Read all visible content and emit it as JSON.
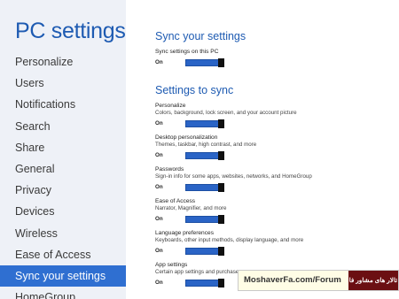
{
  "nav": {
    "title": "PC settings",
    "items": [
      {
        "label": "Personalize"
      },
      {
        "label": "Users"
      },
      {
        "label": "Notifications"
      },
      {
        "label": "Search"
      },
      {
        "label": "Share"
      },
      {
        "label": "General"
      },
      {
        "label": "Privacy"
      },
      {
        "label": "Devices"
      },
      {
        "label": "Wireless"
      },
      {
        "label": "Ease of Access"
      },
      {
        "label": "Sync your settings",
        "selected": true
      },
      {
        "label": "HomeGroup"
      }
    ]
  },
  "main": {
    "sync_section": {
      "title": "Sync your settings",
      "setting": {
        "label": "Sync settings on this PC",
        "state": "On",
        "value": true
      }
    },
    "settings_to_sync": {
      "title": "Settings to sync",
      "items": [
        {
          "label": "Personalize",
          "description": "Colors, background, lock screen, and your account picture",
          "state": "On",
          "value": true
        },
        {
          "label": "Desktop personalization",
          "description": "Themes, taskbar, high contrast, and more",
          "state": "On",
          "value": true
        },
        {
          "label": "Passwords",
          "description": "Sign-in info for some apps, websites, networks, and HomeGroup",
          "state": "On",
          "value": true
        },
        {
          "label": "Ease of Access",
          "description": "Narrator, Magnifier, and more",
          "state": "On",
          "value": true
        },
        {
          "label": "Language preferences",
          "description": "Keyboards, other input methods, display language, and more",
          "state": "On",
          "value": true
        },
        {
          "label": "App settings",
          "description": "Certain app settings and purchase",
          "state": "On",
          "value": true
        }
      ]
    }
  },
  "colors": {
    "accent": "#1e5bb2",
    "selected_bg": "#2f6fd1",
    "toggle_on": "#2a64c6",
    "nav_bg": "#eef1f7"
  },
  "watermark": {
    "text": "MoshaverFa.com/Forum",
    "badge": "تالار های مشاور فا"
  }
}
